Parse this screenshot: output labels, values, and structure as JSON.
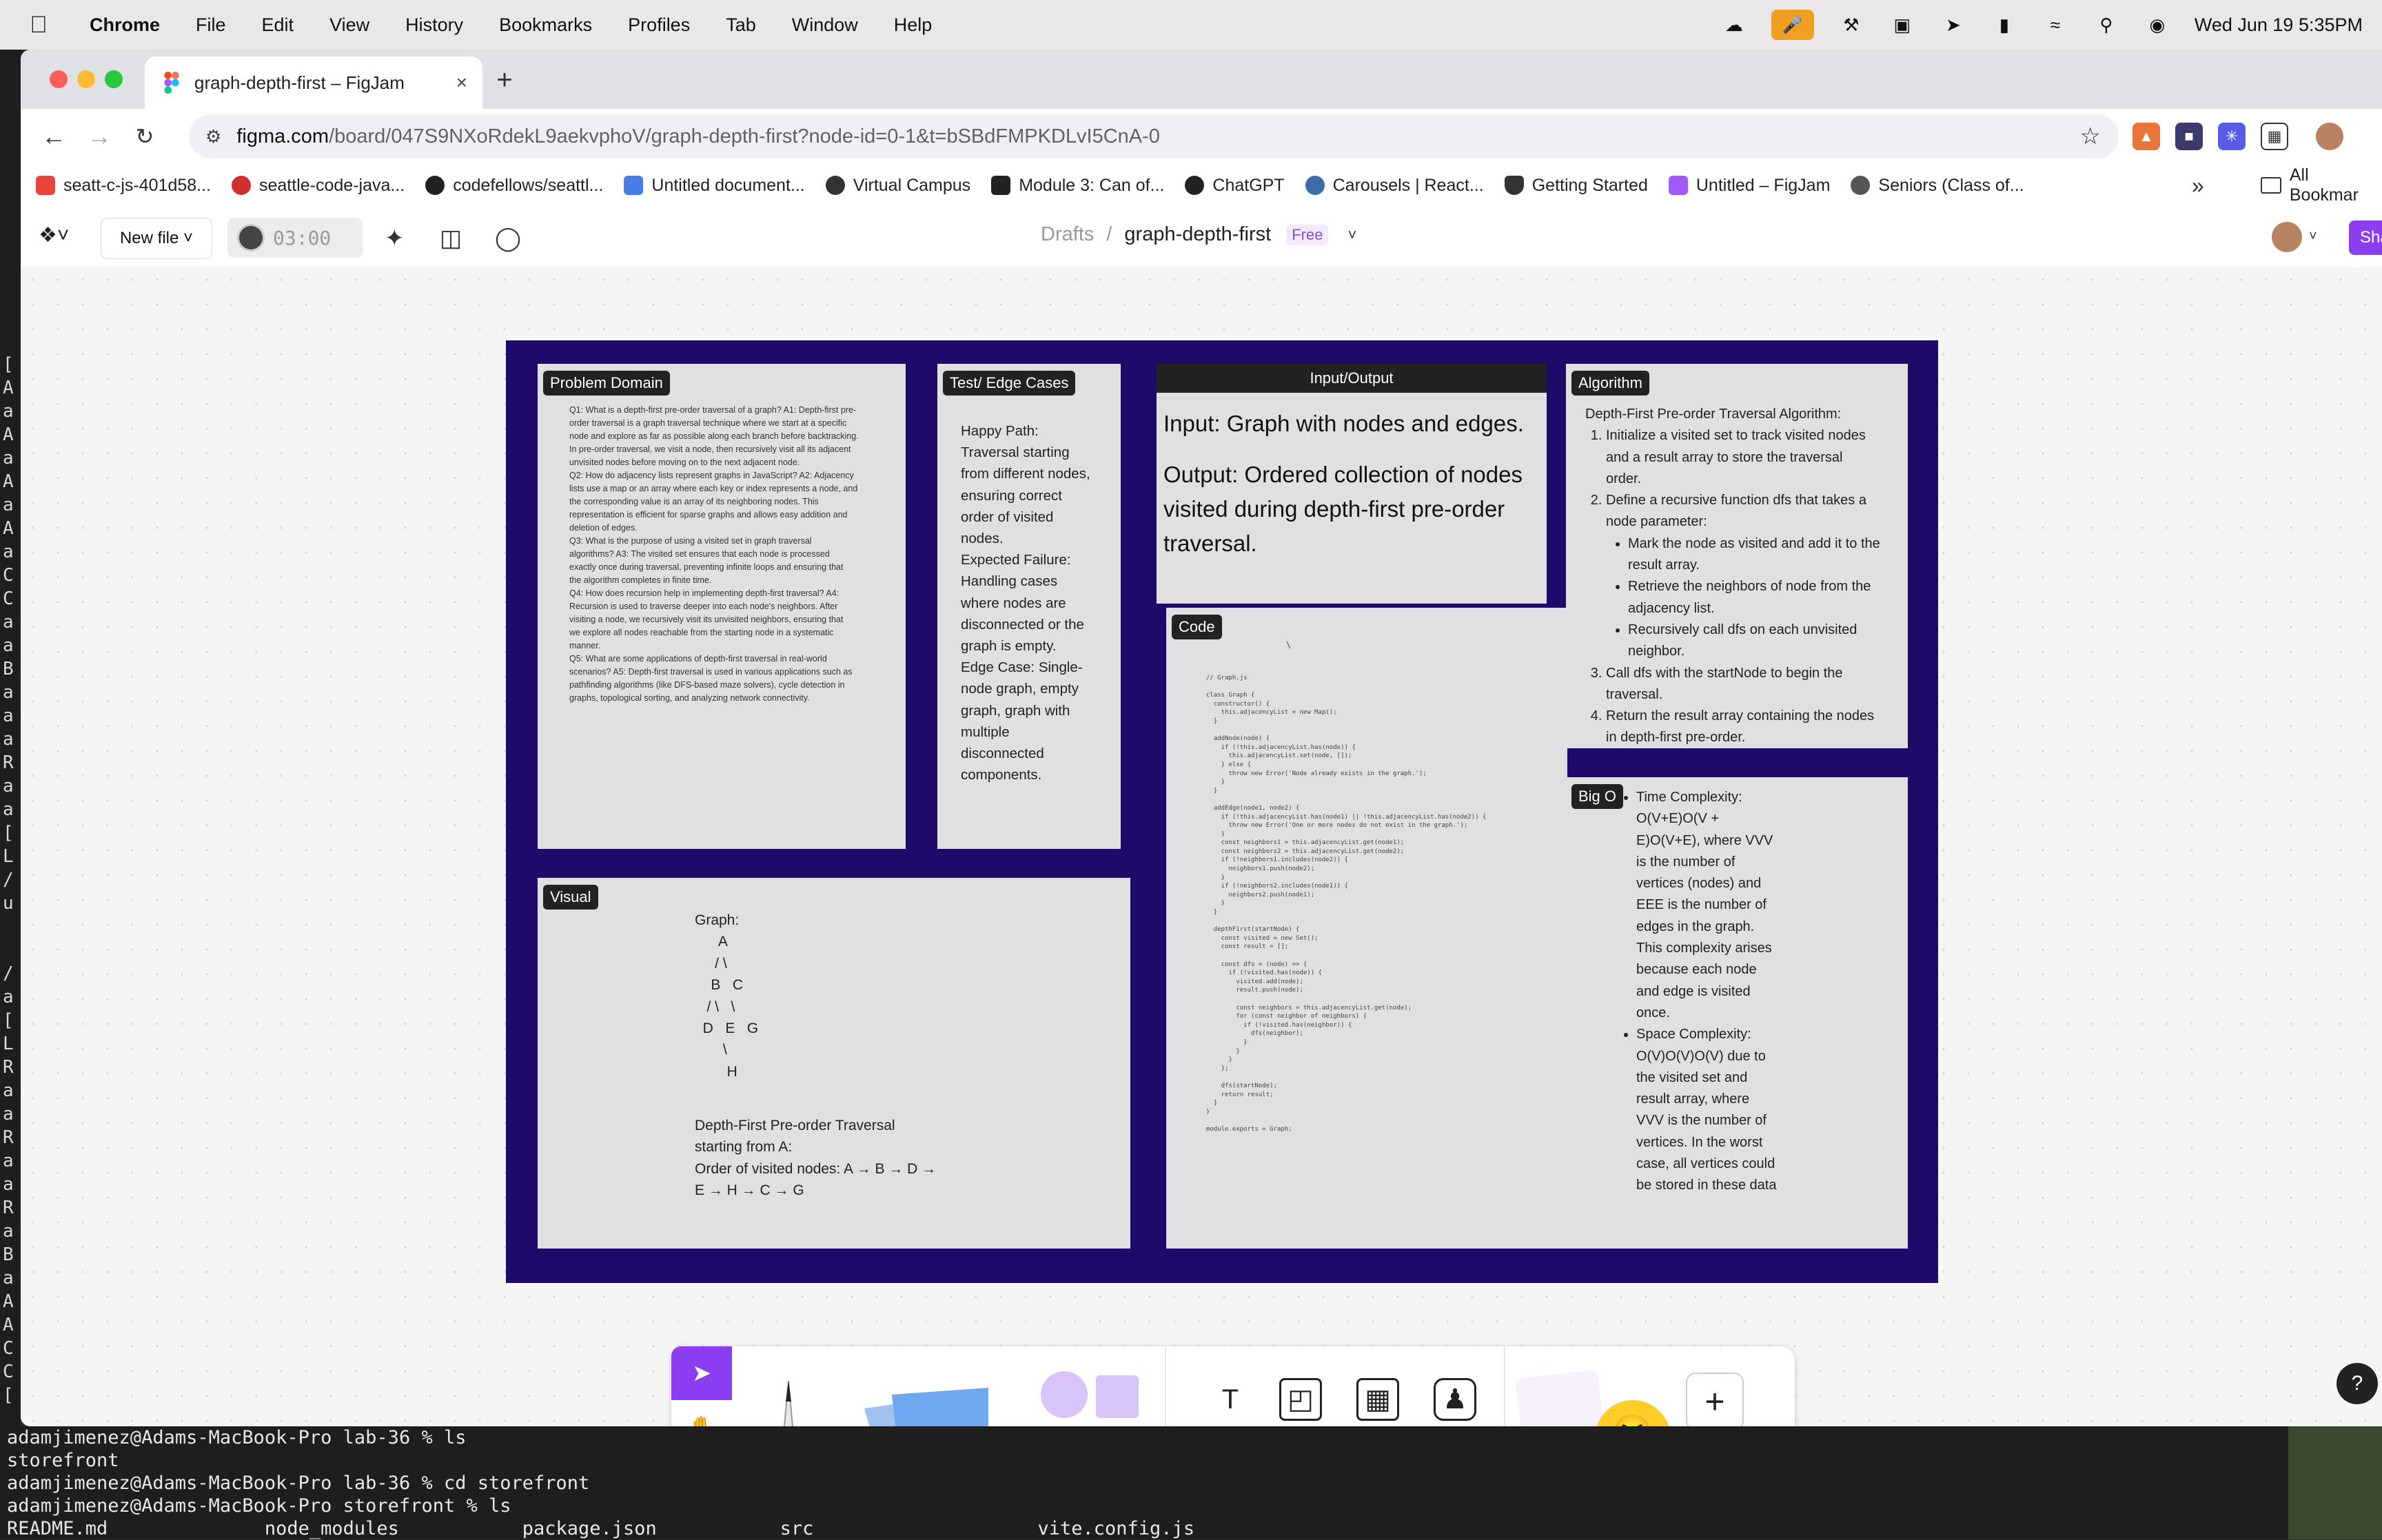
{
  "menubar": {
    "app": "Chrome",
    "items": [
      "File",
      "Edit",
      "View",
      "History",
      "Bookmarks",
      "Profiles",
      "Tab",
      "Window",
      "Help"
    ],
    "datetime": "Wed Jun 19  5:35PM"
  },
  "browser": {
    "tab_title": "graph-depth-first – FigJam",
    "url_host": "figma.com",
    "url_path": "/board/047S9NXoRdekL9aekvphoV/graph-depth-first?node-id=0-1&t=bSBdFMPKDLvI5CnA-0",
    "bookmarks": [
      {
        "label": "seatt-c-js-401d58...",
        "color": "#e8453c"
      },
      {
        "label": "seattle-code-java...",
        "color": "#d03030"
      },
      {
        "label": "codefellows/seattl...",
        "color": "#222222"
      },
      {
        "label": "Untitled document...",
        "color": "#4a7de8"
      },
      {
        "label": "Virtual Campus",
        "color": "#333333"
      },
      {
        "label": "Module 3: Can of...",
        "color": "#222222"
      },
      {
        "label": "ChatGPT",
        "color": "#222222"
      },
      {
        "label": "Carousels | React...",
        "color": "#3b6ea8"
      },
      {
        "label": "Getting Started",
        "color": "#333333"
      },
      {
        "label": "Untitled – FigJam",
        "color": "#a259ff"
      },
      {
        "label": "Seniors (Class of...",
        "color": "#555555"
      }
    ],
    "bookmarks_all": "All Bookmar"
  },
  "figjam": {
    "new_file": "New file",
    "timer": "03:00",
    "breadcrumb_root": "Drafts",
    "file_name": "graph-depth-first",
    "plan_badge": "Free",
    "share_label": "Sha"
  },
  "sections": {
    "problem_domain": {
      "label": "Problem Domain",
      "text": "Q1: What is a depth-first pre-order traversal of a graph? A1: Depth-first pre-\norder traversal is a graph traversal technique where we start at a specific\nnode and explore as far as possible along each branch before backtracking.\nIn pre-order traversal, we visit a node, then recursively visit all its adjacent\nunvisited nodes before moving on to the next adjacent node.\nQ2: How do adjacency lists represent graphs in JavaScript? A2: Adjacency\nlists use a map or an array where each key or index represents a node, and\nthe corresponding value is an array of its neighboring nodes. This\nrepresentation is efficient for sparse graphs and allows easy addition and\ndeletion of edges.\nQ3: What is the purpose of using a visited set in graph traversal\nalgorithms? A3: The visited set ensures that each node is processed\nexactly once during traversal, preventing infinite loops and ensuring that\nthe algorithm completes in finite time.\nQ4: How does recursion help in implementing depth-first traversal? A4:\nRecursion is used to traverse deeper into each node's neighbors. After\nvisiting a node, we recursively visit its unvisited neighbors, ensuring that\nwe explore all nodes reachable from the starting node in a systematic\nmanner.\nQ5: What are some applications of depth-first traversal in real-world\nscenarios? A5: Depth-first traversal is used in various applications such as\npathfinding algorithms (like DFS-based maze solvers), cycle detection in\ngraphs, topological sorting, and analyzing network connectivity."
    },
    "test_edge": {
      "label": "Test/ Edge Cases",
      "text": "Happy Path:\nTraversal starting\nfrom different nodes,\nensuring correct\norder of visited\nnodes.\nExpected Failure:\nHandling cases\nwhere nodes are\ndisconnected or the\ngraph is empty.\nEdge Case: Single-\nnode graph, empty\ngraph, graph with\nmultiple\ndisconnected\ncomponents."
    },
    "input_output": {
      "label": "Input/Output",
      "input": "Input: Graph with nodes and edges.",
      "output": "Output: Ordered collection of nodes\nvisited during depth-first pre-order\ntraversal."
    },
    "algorithm": {
      "label": "Algorithm",
      "intro": "Depth-First Pre-order Traversal Algorithm:",
      "step1": "Initialize a visited set to track visited nodes and a result array to store the traversal order.",
      "step2": "Define a recursive function dfs that takes a node parameter:",
      "step2a": "Mark the node as visited and add it to the result array.",
      "step2b": "Retrieve the neighbors of node from the adjacency list.",
      "step2c": "Recursively call dfs on each unvisited neighbor.",
      "step3": "Call dfs with the startNode to begin the traversal.",
      "step4": "Return the result array containing the nodes in depth-first pre-order."
    },
    "code": {
      "label": "Code",
      "brace": "\\",
      "text": "// Graph.js\n\nclass Graph {\n  constructor() {\n    this.adjacencyList = new Map();\n  }\n\n  addNode(node) {\n    if (!this.adjacencyList.has(node)) {\n      this.adjacencyList.set(node, []);\n    } else {\n      throw new Error('Node already exists in the graph.');\n    }\n  }\n\n  addEdge(node1, node2) {\n    if (!this.adjacencyList.has(node1) || !this.adjacencyList.has(node2)) {\n      throw new Error('One or more nodes do not exist in the graph.');\n    }\n    const neighbors1 = this.adjacencyList.get(node1);\n    const neighbors2 = this.adjacencyList.get(node2);\n    if (!neighbors1.includes(node2)) {\n      neighbors1.push(node2);\n    }\n    if (!neighbors2.includes(node1)) {\n      neighbors2.push(node1);\n    }\n  }\n\n  depthFirst(startNode) {\n    const visited = new Set();\n    const result = [];\n\n    const dfs = (node) => {\n      if (!visited.has(node)) {\n        visited.add(node);\n        result.push(node);\n\n        const neighbors = this.adjacencyList.get(node);\n        for (const neighbor of neighbors) {\n          if (!visited.has(neighbor)) {\n            dfs(neighbor);\n          }\n        }\n      }\n    };\n\n    dfs(startNode);\n    return result;\n  }\n}\n\nmodule.exports = Graph;"
    },
    "visual": {
      "label": "Visual",
      "graph": "Graph:\n      A\n     / \\\n    B   C\n   / \\   \\\n  D   E   G\n       \\\n        H",
      "traversal": "Depth-First Pre-order Traversal\nstarting from A:\nOrder of visited nodes: A → B → D →\nE → H → C → G"
    },
    "big_o": {
      "label": "Big O",
      "time": "Time Complexity: O(V+E)O(V + E)O(V+E), where VVV is the number of vertices (nodes) and EEE is the number of edges in the graph. This complexity arises because each node and edge is visited once.",
      "space": "Space Complexity: O(V)O(V)O(V) due to the visited set and result array, where VVV is the number of vertices. In the worst case, all vertices could be stored in these data"
    }
  },
  "terminal": {
    "lines": [
      "adamjimenez@Adams-MacBook-Pro lab-36 % ls",
      "storefront",
      "adamjimenez@Adams-MacBook-Pro lab-36 % cd storefront",
      "adamjimenez@Adams-MacBook-Pro storefront % ls",
      "README.md              node_modules           package.json           src                    vite.config.js"
    ],
    "left_column": "[\nA\na\nA\na\nA\na\nA\na\nC\nC\na\na\nB\na\na\na\nR\na\na\n[\nL\n/\nu\n\n\n/\na\n[\nL\nR\na\na\nR\na\na\nR\na\nB\na\nA\nA\nC\nC\n["
  }
}
